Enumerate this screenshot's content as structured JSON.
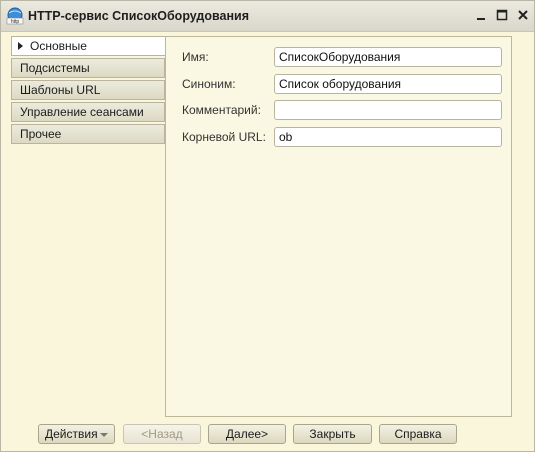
{
  "window": {
    "title": "HTTP-сервис СписокОборудования",
    "icon": "http-globe-icon",
    "controls": {
      "minimize": "_",
      "maximize": "□",
      "close": "✕"
    }
  },
  "tabs": [
    {
      "label": "Основные",
      "active": true
    },
    {
      "label": "Подсистемы",
      "active": false
    },
    {
      "label": "Шаблоны URL",
      "active": false
    },
    {
      "label": "Управление сеансами",
      "active": false
    },
    {
      "label": "Прочее",
      "active": false
    }
  ],
  "form": {
    "name": {
      "label": "Имя:",
      "value": "СписокОборудования"
    },
    "synonym": {
      "label": "Синоним:",
      "value": "Список оборудования"
    },
    "comment": {
      "label": "Комментарий:",
      "value": ""
    },
    "root_url": {
      "label": "Корневой URL:",
      "value": "ob"
    }
  },
  "footer": {
    "actions": "Действия",
    "back": "<Назад",
    "next": "Далее>",
    "close": "Закрыть",
    "help": "Справка"
  }
}
